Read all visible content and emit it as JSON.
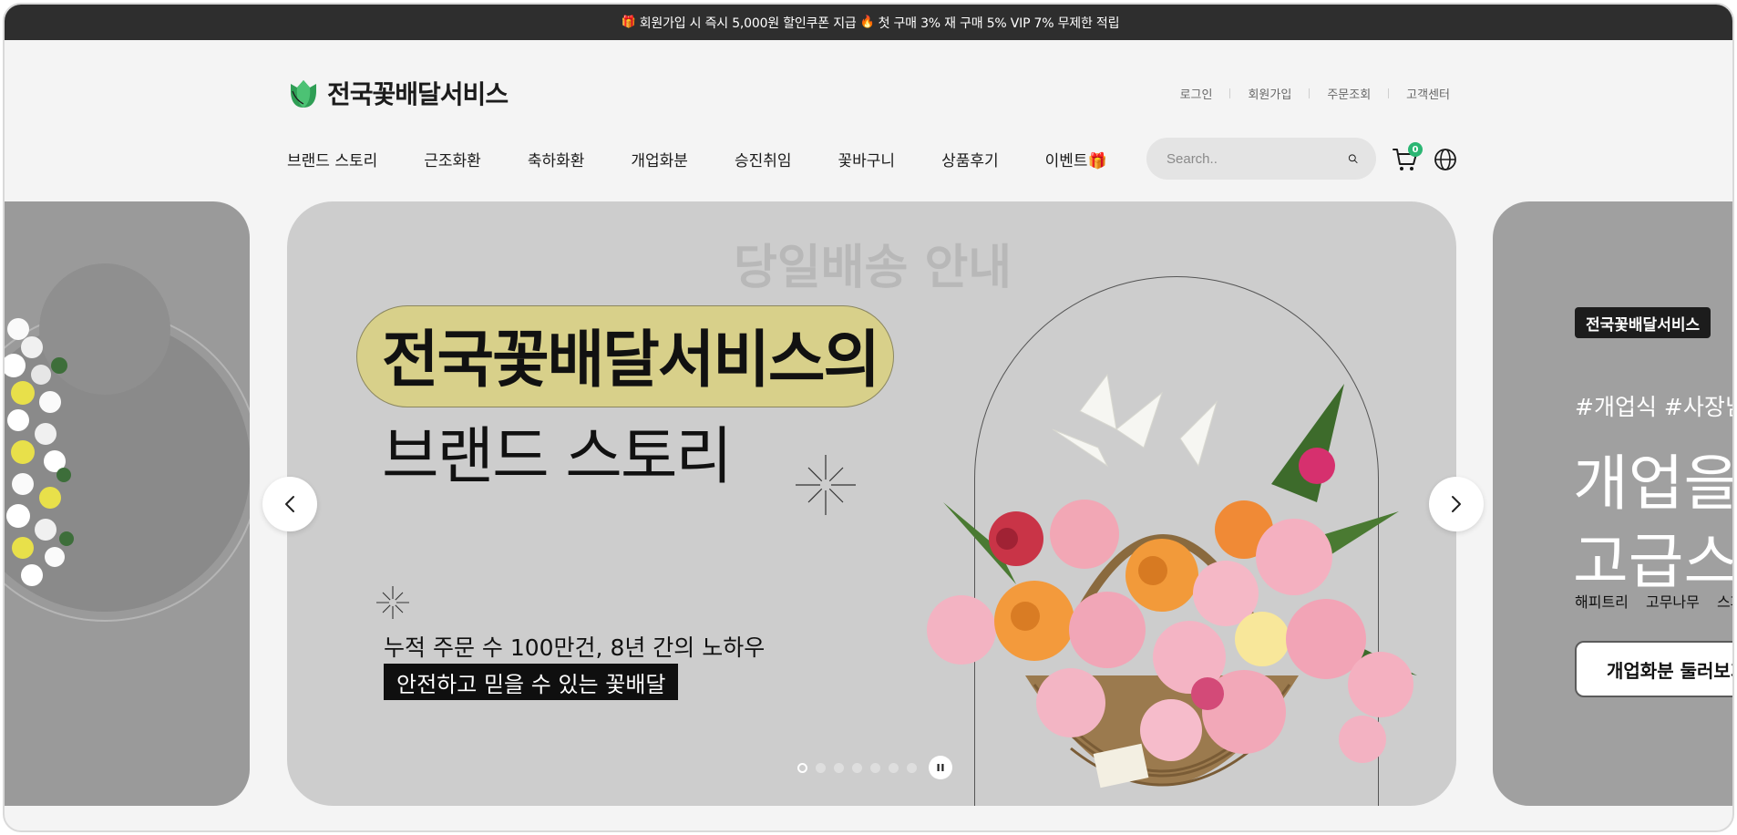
{
  "promo": {
    "part1": "회원가입 시 즉시 5,000원 할인쿠폰 지급",
    "part2": "첫 구매 3% 재 구매 5% VIP 7% 무제한 적립"
  },
  "header": {
    "logo_text": "전국꽃배달서비스",
    "util": [
      "로그인",
      "회원가입",
      "주문조회",
      "고객센터"
    ],
    "nav": [
      "브랜드 스토리",
      "근조화환",
      "축하화환",
      "개업화분",
      "승진취임",
      "꽃바구니",
      "상품후기",
      "이벤트🎁"
    ],
    "search_placeholder": "Search..",
    "cart_count": "0"
  },
  "hero": {
    "ghost_title": "당일배송 안내",
    "line1_highlight": "전국꽃배달서비스",
    "line1_suffix": "의",
    "line2": "브랜드 스토리",
    "sub1": "누적 주문 수 100만건, 8년 간의 노하우",
    "sub2": "안전하고 믿을 수 있는 꽃배달",
    "dots_total": 7,
    "active_dot": 1
  },
  "next_slide": {
    "badge": "전국꽃배달서비스",
    "tags": "#개업식 #사장님 #",
    "big1": "개업을",
    "big2": "고급스러",
    "brands": [
      "해피트리",
      "고무나무",
      "스파트"
    ],
    "button": "개업화분 둘러보기"
  },
  "colors": {
    "promo_bg": "#2e2e2e",
    "highlight": "#d8d08a",
    "cart_badge": "#2bb673",
    "logo_green": "#2f9e55"
  }
}
